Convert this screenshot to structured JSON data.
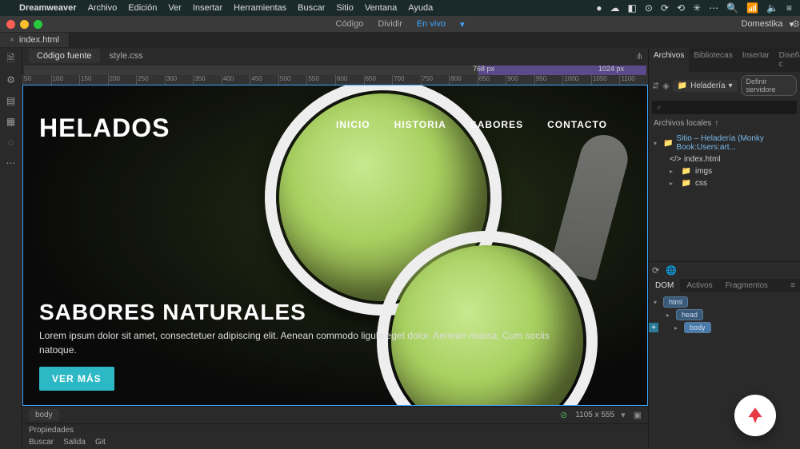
{
  "menubar": {
    "apple": "",
    "app": "Dreamweaver",
    "items": [
      "Archivo",
      "Edición",
      "Ver",
      "Insertar",
      "Herramientas",
      "Buscar",
      "Sitio",
      "Ventana",
      "Ayuda"
    ],
    "status_icons": [
      "●",
      "☁",
      "◧",
      "⊙",
      "⟳",
      "⟲",
      "✳",
      "⋯",
      "🔍",
      "📶",
      "🔈",
      "≡"
    ]
  },
  "window": {
    "views": {
      "code": "Código",
      "split": "Dividir",
      "live": "En vivo"
    },
    "user": "Domestika",
    "gear": "⚙"
  },
  "tabs": {
    "file": "index.html"
  },
  "subtabs": {
    "source": "Código fuente",
    "css": "style.css",
    "filter": "⋔"
  },
  "ruler": {
    "left_label": "768 px",
    "right_label": "1024 px",
    "ticks": [
      "50",
      "100",
      "150",
      "200",
      "250",
      "300",
      "350",
      "400",
      "450",
      "500",
      "550",
      "600",
      "650",
      "700",
      "750",
      "800",
      "850",
      "900",
      "950",
      "1000",
      "1050",
      "1100"
    ]
  },
  "hero": {
    "logo": "HELADOS",
    "nav": [
      "INICIO",
      "HISTORIA",
      "SABORES",
      "CONTACTO"
    ],
    "title": "SABORES NATURALES",
    "text": "Lorem ipsum dolor sit amet, consectetuer adipiscing elit. Aenean commodo ligula eget dolor. Aenean massa. Cum sociis natoque.",
    "button": "VER MÁS"
  },
  "statusbar": {
    "path": "body",
    "check": "⊘",
    "dimensions": "1105 x 555"
  },
  "properties": {
    "label": "Propiedades"
  },
  "bottom_tabs": {
    "search": "Buscar",
    "output": "Salida",
    "git": "Git"
  },
  "right": {
    "panel_tabs": {
      "files": "Archivos",
      "libs": "Bibliotecas",
      "insert": "Insertar",
      "designer": "Diseñador c"
    },
    "site_name": "Heladería",
    "define": "Definir servidore",
    "search_placeholder": "⌕",
    "local_files": "Archivos locales",
    "root": "Sitio – Heladería (Monky Book:Users:art...",
    "tree": {
      "index": "index.html",
      "imgs": "imgs",
      "css": "css"
    },
    "dom_tabs": {
      "dom": "DOM",
      "assets": "Activos",
      "fragments": "Fragmentos"
    },
    "dom": {
      "html": "html",
      "head": "head",
      "body": "body"
    },
    "refresh": "⟳",
    "globe": "🌐",
    "plus": "+"
  }
}
